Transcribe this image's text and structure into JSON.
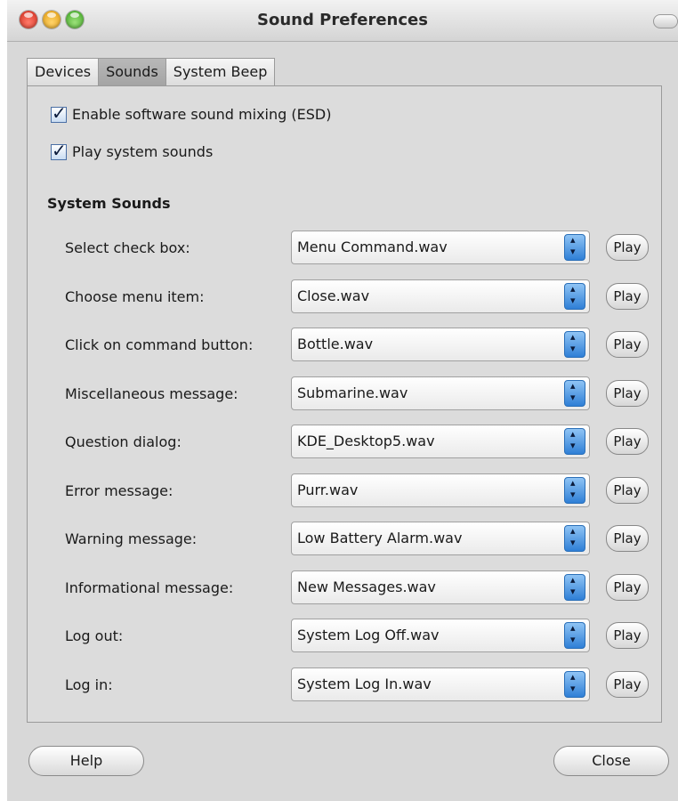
{
  "window": {
    "title": "Sound Preferences"
  },
  "tabs": [
    {
      "label": "Devices"
    },
    {
      "label": "Sounds"
    },
    {
      "label": "System Beep"
    }
  ],
  "options": {
    "esd_label": "Enable software sound mixing (ESD)",
    "esd_checked": true,
    "system_sounds_label": "Play system sounds",
    "system_sounds_checked": true
  },
  "section_title": "System Sounds",
  "play_label": "Play",
  "rows": [
    {
      "label": "Select check box:",
      "value": "Menu Command.wav"
    },
    {
      "label": "Choose menu item:",
      "value": "Close.wav"
    },
    {
      "label": "Click on command button:",
      "value": "Bottle.wav"
    },
    {
      "label": "Miscellaneous message:",
      "value": "Submarine.wav"
    },
    {
      "label": "Question dialog:",
      "value": "KDE_Desktop5.wav"
    },
    {
      "label": "Error message:",
      "value": "Purr.wav"
    },
    {
      "label": "Warning message:",
      "value": "Low Battery Alarm.wav"
    },
    {
      "label": "Informational message:",
      "value": "New Messages.wav"
    },
    {
      "label": "Log out:",
      "value": "System Log Off.wav"
    },
    {
      "label": "Log in:",
      "value": "System Log In.wav"
    }
  ],
  "buttons": {
    "help": "Help",
    "close": "Close"
  }
}
